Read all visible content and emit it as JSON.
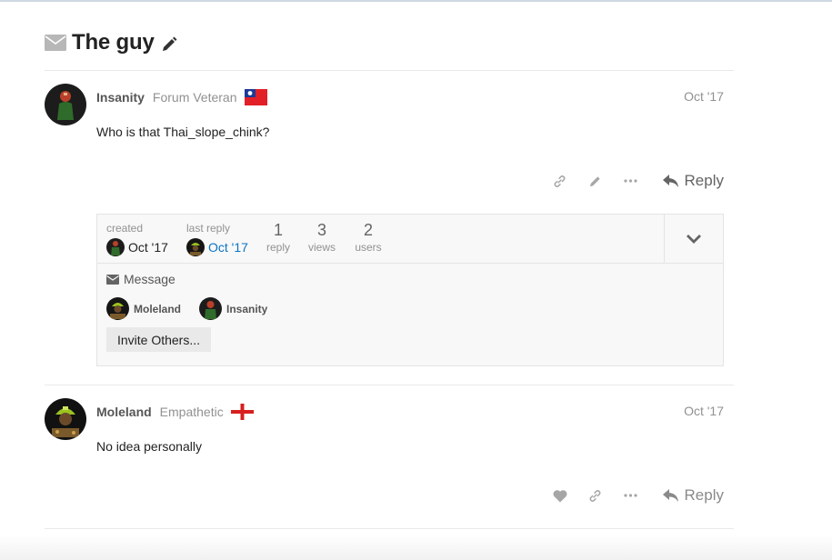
{
  "topic": {
    "title": "The guy"
  },
  "posts": [
    {
      "username": "Insanity",
      "user_title": "Forum Veteran",
      "flag": "taiwan-flag",
      "date": "Oct '17",
      "body": "Who is that Thai_slope_chink?",
      "reply_label": "Reply"
    },
    {
      "username": "Moleland",
      "user_title": "Empathetic",
      "flag": "england-flag",
      "date": "Oct '17",
      "body": "No idea personally",
      "reply_label": "Reply"
    }
  ],
  "topic_map": {
    "created_label": "created",
    "created_date": "Oct '17",
    "last_reply_label": "last reply",
    "last_reply_date": "Oct '17",
    "replies_count": "1",
    "replies_label": "reply",
    "views_count": "3",
    "views_label": "views",
    "users_count": "2",
    "users_label": "users",
    "message_label": "Message",
    "participants": [
      "Moleland",
      "Insanity"
    ],
    "invite_label": "Invite Others..."
  },
  "colors": {
    "link": "#0a74c2",
    "muted": "#919191",
    "flag_red": "#d81e1e"
  }
}
